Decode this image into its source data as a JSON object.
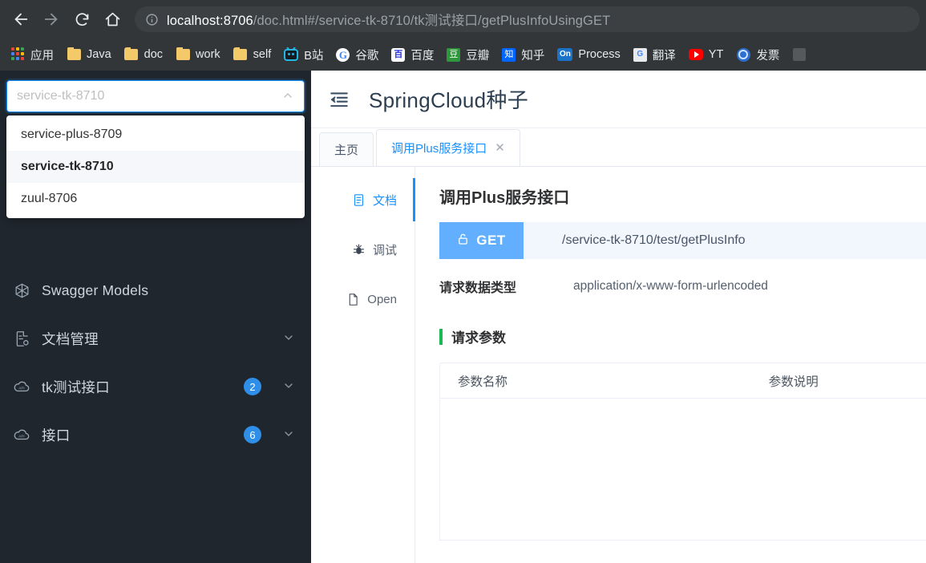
{
  "browser": {
    "nav": {
      "back": "back-arrow",
      "forward": "forward-arrow",
      "reload": "reload",
      "home": "home"
    },
    "omnibox": {
      "site_info_icon": "info-circle-icon",
      "url_host": "localhost:8706",
      "url_path": "/doc.html#/service-tk-8710/tk测试接口/getPlusInfoUsingGET",
      "url_full": "localhost:8706/doc.html#/service-tk-8710/tk测试接口/getPlusInfoUsingGET"
    },
    "bookmarks": [
      {
        "label": "应用",
        "icon": "apps-grid-icon"
      },
      {
        "label": "Java",
        "icon": "folder-icon"
      },
      {
        "label": "doc",
        "icon": "folder-icon"
      },
      {
        "label": "work",
        "icon": "folder-icon"
      },
      {
        "label": "self",
        "icon": "folder-icon"
      },
      {
        "label": "B站",
        "icon": "bilibili-icon"
      },
      {
        "label": "谷歌",
        "icon": "google-icon",
        "glyph": "G"
      },
      {
        "label": "百度",
        "icon": "baidu-icon",
        "glyph": "百"
      },
      {
        "label": "豆瓣",
        "icon": "douban-icon",
        "glyph": "豆"
      },
      {
        "label": "知乎",
        "icon": "zhihu-icon",
        "glyph": "知"
      },
      {
        "label": "Process",
        "icon": "on-process-icon",
        "glyph": "On"
      },
      {
        "label": "翻译",
        "icon": "google-translate-icon",
        "glyph": "G"
      },
      {
        "label": "YT",
        "icon": "youtube-icon"
      },
      {
        "label": "发票",
        "icon": "fapiao-search-icon"
      },
      {
        "label": "",
        "icon": "clipped-bookmark-icon"
      }
    ]
  },
  "sidebar": {
    "service_select": {
      "value": "service-tk-8710",
      "placeholder": "service-tk-8710",
      "chevron": "chevron-up-icon",
      "expanded": true,
      "options": [
        {
          "label": "service-plus-8709",
          "selected": false
        },
        {
          "label": "service-tk-8710",
          "selected": true
        },
        {
          "label": "zuul-8706",
          "selected": false
        }
      ]
    },
    "menu": [
      {
        "label": "Swagger Models",
        "icon": "models-cube-icon",
        "badge": "",
        "chevron": ""
      },
      {
        "label": "文档管理",
        "icon": "doc-settings-icon",
        "badge": "",
        "chevron": "chevron-down-icon"
      },
      {
        "label": "tk测试接口",
        "icon": "cloud-api-icon",
        "badge": "2",
        "chevron": "chevron-down-icon"
      },
      {
        "label": "接口",
        "icon": "cloud-api-icon",
        "badge": "6",
        "chevron": "chevron-down-icon"
      }
    ]
  },
  "main": {
    "header": {
      "collapse_icon": "menu-fold-icon",
      "title": "SpringCloud种子"
    },
    "tabs": [
      {
        "label": "主页",
        "active": false,
        "closable": false
      },
      {
        "label": "调用Plus服务接口",
        "active": true,
        "closable": true,
        "close_glyph": "✕"
      }
    ],
    "vertical_tabs": [
      {
        "label": "文档",
        "icon": "document-icon",
        "active": true
      },
      {
        "label": "调试",
        "icon": "bug-icon",
        "active": false
      },
      {
        "label": "Open",
        "icon": "file-icon",
        "active": false
      }
    ],
    "doc": {
      "api_title": "调用Plus服务接口",
      "method": "GET",
      "method_lock_icon": "unlock-icon",
      "path": "/service-tk-8710/test/getPlusInfo",
      "content_type_label": "请求数据类型",
      "content_type_value": "application/x-www-form-urlencoded",
      "params_section_title": "请求参数",
      "params_table": {
        "columns": [
          "参数名称",
          "参数说明"
        ],
        "rows": []
      }
    }
  },
  "colors": {
    "sidebar_bg": "#1f262e",
    "accent_blue": "#1890ff",
    "method_get": "#61affe",
    "url_row_bg": "#f2f7fd",
    "badge_blue": "#2f8fe8",
    "section_bar_green": "#19b955",
    "chrome_bg": "#323639"
  }
}
